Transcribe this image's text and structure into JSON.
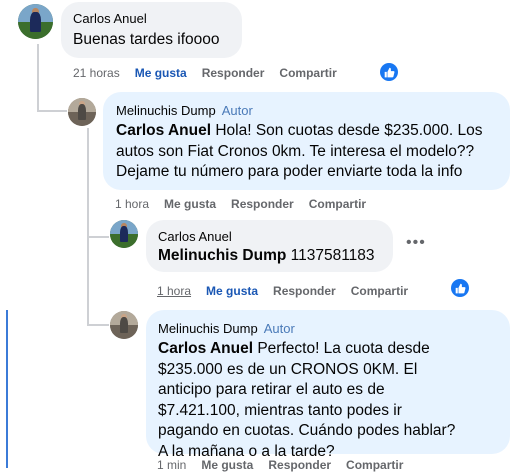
{
  "comments": [
    {
      "author": "Carlos Anuel",
      "text": "Buenas tardes ifoooo",
      "time": "21 horas",
      "like": "Me gusta",
      "reply": "Responder",
      "share": "Compartir"
    },
    {
      "author": "Melinuchis Dump",
      "badge": "Autor",
      "mention": "Carlos Anuel",
      "text": "Hola! Son cuotas desde $235.000. Los autos son Fiat Cronos 0km. Te interesa el modelo?? Dejame tu número para poder enviarte toda la info",
      "time": "1 hora",
      "like": "Me gusta",
      "reply": "Responder",
      "share": "Compartir"
    },
    {
      "author": "Carlos Anuel",
      "mention": "Melinuchis Dump",
      "text": "1137581183",
      "time": "1 hora",
      "like": "Me gusta",
      "reply": "Responder",
      "share": "Compartir"
    },
    {
      "author": "Melinuchis Dump",
      "badge": "Autor",
      "mention": "Carlos Anuel",
      "text": "Perfecto! La cuota desde $235.000 es de un CRONOS 0KM. El anticipo para retirar el auto es de $7.421.100, mientras tanto podes ir pagando en cuotas. Cuándo podes hablar? A la mañana o a la tarde?",
      "time": "1 min",
      "like": "Me gusta",
      "reply": "Responder",
      "share": "Compartir"
    }
  ],
  "colors": {
    "like_blue": "#1877f2",
    "author_bubble": "#e7f3ff",
    "bubble": "#f0f2f5"
  },
  "icons": [
    "thumbs-up-icon",
    "more-options-icon"
  ]
}
